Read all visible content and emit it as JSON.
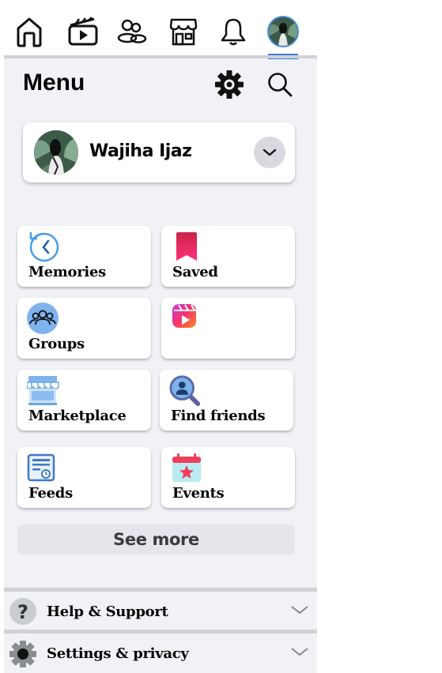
{
  "menu": {
    "title": "Menu"
  },
  "profile": {
    "name": "Wajiha Ijaz"
  },
  "shortcuts": [
    {
      "label": "Memories"
    },
    {
      "label": "Saved"
    },
    {
      "label": "Groups"
    },
    {
      "label": ""
    },
    {
      "label": "Marketplace"
    },
    {
      "label": "Find friends"
    },
    {
      "label": "Feeds"
    },
    {
      "label": "Events"
    }
  ],
  "see_more": {
    "label": "See more"
  },
  "sections": [
    {
      "label": "Help & Support"
    },
    {
      "label": "Settings & privacy"
    }
  ],
  "colors": {
    "accent": "#3b7ddd",
    "saved": "#e8175d",
    "background": "#f0f2f5"
  },
  "icons": {
    "nav": [
      "home-icon",
      "video-icon",
      "friends-icon",
      "marketplace-icon",
      "bell-icon",
      "profile-avatar"
    ],
    "header": [
      "gear-icon",
      "search-icon"
    ]
  }
}
